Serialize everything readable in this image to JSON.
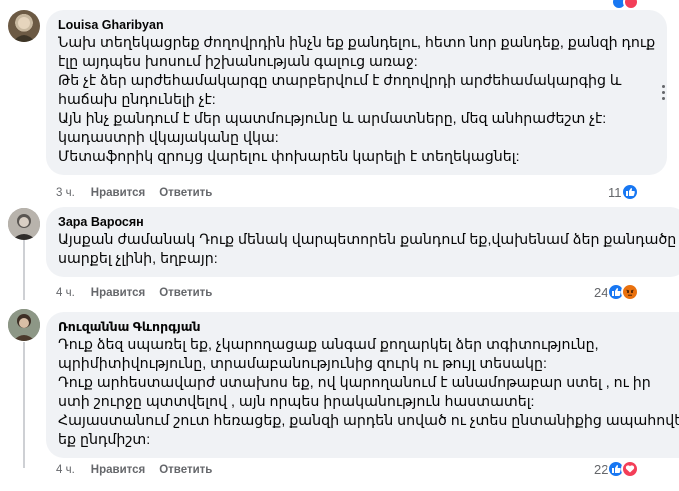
{
  "comments": [
    {
      "author": "Louisa Gharibyan",
      "lines": [
        "Նախ տեղեկացրեք ժողովրդին ինչն եք քանդելու, հետո նոր քանդեք, քանզի դուք",
        "էլը այդպես խոսում իշխանության գալուց առաջ:",
        "Թե չէ ձեր արժեհամակարգը տարբերվում է ժողովրդի արժեհամակարգից և",
        "հաճախ ընդունելի չէ:",
        "Այն ինչ քանդում է մեր պատմությունը և արմատները, մեզ անհրաժեշտ չէ:",
        "կադաստրի վկայականը վկա:",
        "Մետաֆորիկ զրույց վարելու փոխարեն կարելի է տեղեկացնել:"
      ],
      "time": "3 ч.",
      "like_label": "Нравится",
      "reply_label": "Ответить",
      "reaction_count": "11",
      "reactions": [
        "like"
      ]
    },
    {
      "author": "Зара Варосян",
      "lines": [
        "Այսքան ժամանակ Դուք մենակ վարպետորեն քանդում եք,վախենամ ձեր քանդածը",
        "սարքել չլինի, եղբայր:"
      ],
      "time": "4 ч.",
      "like_label": "Нравится",
      "reply_label": "Ответить",
      "reaction_count": "24",
      "reactions": [
        "like",
        "angry"
      ]
    },
    {
      "author": "Ռուզաննա Գևորգյան",
      "lines": [
        "Դուք ձեզ սպառել եք, չկարողացաք անգամ քողարկել ձեր տգիտությունը,",
        "պրիմիտիվությունը, տրամաբանությունից զուրկ ու թույլ տեսակը:",
        "Դուք արհեստավարժ ստախոս եք, ով կարողանում է անամոթաբար ստել , ու իր",
        "ստի շուրջը պտտվելով , այն որպես իրականություն հաստատել:",
        "Հայաստանում շուտ հեռացեք, քանզի արդեն սոված ու չտես ընտանիքից ապահովել",
        "եք ընդմիշտ:"
      ],
      "time": "4 ч.",
      "like_label": "Нравится",
      "reply_label": "Ответить",
      "reaction_count": "22",
      "reactions": [
        "like",
        "love"
      ]
    }
  ],
  "colors": {
    "like": "#1877f2",
    "love": "#f33e58",
    "angry": "#e9710f",
    "bubble": "#f0f2f5",
    "meta": "#65676b"
  },
  "icons": {
    "more": "more-options-icon"
  }
}
